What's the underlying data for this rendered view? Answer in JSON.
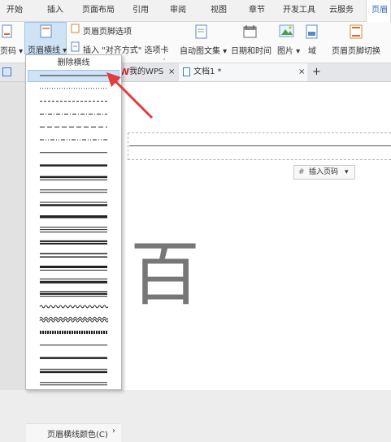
{
  "menu_tabs": [
    "开始",
    "插入",
    "页面布局",
    "引用",
    "审阅",
    "视图",
    "章节",
    "开发工具",
    "云服务",
    "页眉和"
  ],
  "ribbon": {
    "page_number": "页码",
    "header_line": "页眉横线",
    "header_footer_options": "页眉页脚选项",
    "insert_align_tab": "插入 \"对齐方式\" 选项卡",
    "auto_text": "自动图文集",
    "date_time": "日期和时间",
    "picture": "图片",
    "field": "域",
    "header_footer_switch": "页眉页脚切换"
  },
  "doc_tabs": [
    {
      "label": "我的WPS",
      "close": "×"
    },
    {
      "label": "文档1 *",
      "close": "×"
    }
  ],
  "new_tab": "+",
  "dropdown": {
    "delete_line": "删除横线",
    "line_color": "页眉横线颜色(C)",
    "arrow": "›",
    "line_styles": [
      "thin",
      "dotted",
      "dashed",
      "dash-dot",
      "long-dash",
      "dash-dot-dot",
      "thin-2",
      "thick",
      "thick-thin",
      "double",
      "thin-thick",
      "thick-2",
      "triple",
      "double-thick",
      "double-2",
      "thick-thin-2",
      "thin-thick-2",
      "thin-thick-thin",
      "wavy",
      "double-wavy",
      "striped",
      "thin-3",
      "thick-3",
      "thin-thick-3",
      "double-3"
    ]
  },
  "header_area": {
    "insert_page_number": "插入页码"
  },
  "document": {
    "char": "百"
  },
  "colors": {
    "accent": "#2b69b5",
    "arrow": "#e33c3c",
    "selection": "#cfe3f7"
  }
}
